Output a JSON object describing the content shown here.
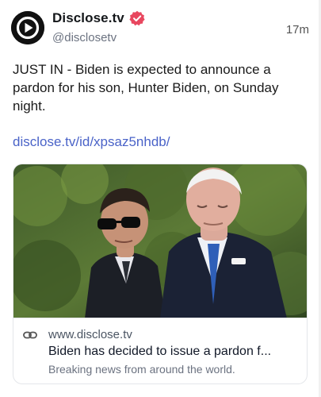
{
  "author": {
    "display_name": "Disclose.tv",
    "handle": "@disclosetv",
    "avatar_icon": "play-button-logo",
    "verified_badge": "verified-badge-icon",
    "verified_color": "#e8475f"
  },
  "post": {
    "timestamp": "17m",
    "text": "JUST IN - Biden is expected to announce a pardon for his son, Hunter Biden, on Sunday night.",
    "link": "disclose.tv/id/xpsaz5nhdb/",
    "link_color": "#4a63c8"
  },
  "card": {
    "domain": "www.disclose.tv",
    "title": "Biden has decided to issue a pardon f...",
    "description": "Breaking news from around the world.",
    "link_icon": "chain-link-icon"
  }
}
